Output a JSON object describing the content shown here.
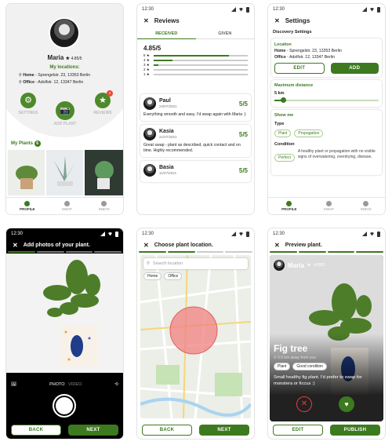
{
  "time": "12:30",
  "profile": {
    "name": "Maria",
    "rating": "4.85/5",
    "my_locations_label": "My locations:",
    "home_label": "Home",
    "home_addr": " - Sprengelstr. 23, 13353 Berlin",
    "office_label": "Office",
    "office_addr": " - Adolfstr. 12, 13347 Berlin",
    "settings_label": "SETTINGS",
    "add_plant_label": "ADD PLANT",
    "reviews_label": "REVIEWS",
    "reviews_badge": "1",
    "my_plants_label": "My Plants",
    "my_plants_count": "6"
  },
  "nav": {
    "profile": "PROFILE",
    "swap": "SWAP",
    "inbox": "INBOX"
  },
  "reviews": {
    "title": "Reviews",
    "tab_received": "RECEIVED",
    "tab_given": "GIVEN",
    "overall": "4.85/5",
    "dist": [
      {
        "label": "5 ★",
        "fraction": 0.8
      },
      {
        "label": "4 ★",
        "fraction": 0.2
      },
      {
        "label": "3 ★",
        "fraction": 0.05
      },
      {
        "label": "2 ★",
        "fraction": 0
      },
      {
        "label": "1 ★",
        "fraction": 0
      }
    ],
    "items": [
      {
        "name": "Paul",
        "date": "24/07/2021",
        "score": "5/5",
        "text": "Everything smooth and easy. I'd swap again with Maria :)"
      },
      {
        "name": "Kasia",
        "date": "21/07/2021",
        "score": "5/5",
        "text": "Great swap - plant as described, quick contact and on time. Highly recommended."
      },
      {
        "name": "Basia",
        "date": "11/07/2021",
        "score": "5/5",
        "text": ""
      }
    ]
  },
  "settings": {
    "title": "Settings",
    "discovery_label": "Discovery Settings",
    "location_label": "Location",
    "loc_home": "Home",
    "loc_home_addr": " - Sprengelstr. 23, 13353 Berlin",
    "loc_office": "Office",
    "loc_office_addr": " - Adolfstr. 12, 13347 Berlin",
    "edit_label": "EDIT",
    "add_label": "ADD",
    "max_distance_label": "Maximum distance",
    "distance_value": "5 km",
    "show_me_label": "Show me",
    "type_label": "Type",
    "type_plant": "Plant",
    "type_propagation": "Propagation",
    "condition_label": "Condition",
    "condition_perfect": "Perfect",
    "condition_desc": "A healthy plant or propagation with no visible signs of overwatering, overdrying, disease."
  },
  "camera": {
    "title": "Add photos of your plant.",
    "mode_photo": "PHOTO",
    "mode_video": "VIDEO",
    "back_label": "BACK",
    "next_label": "NEXT"
  },
  "location": {
    "title": "Choose plant location.",
    "search_placeholder": "Search location",
    "chip_home": "Home",
    "chip_office": "Office",
    "back_label": "BACK",
    "next_label": "NEXT"
  },
  "preview": {
    "title": "Preview plant.",
    "owner_name": "Maria",
    "owner_rating": "4.85/5",
    "plant_name": "Fig tree",
    "distance": "0.5 km away from you",
    "tag_plant": "Plant",
    "tag_condition": "Good condition",
    "description": "Small healthy fig plant. I'd prefer to swap for monstera or ficcus :)",
    "edit_label": "EDIT",
    "publish_label": "PUBLISH"
  },
  "colors": {
    "accent": "#3d7a1f",
    "map_circle": "#f08080"
  }
}
